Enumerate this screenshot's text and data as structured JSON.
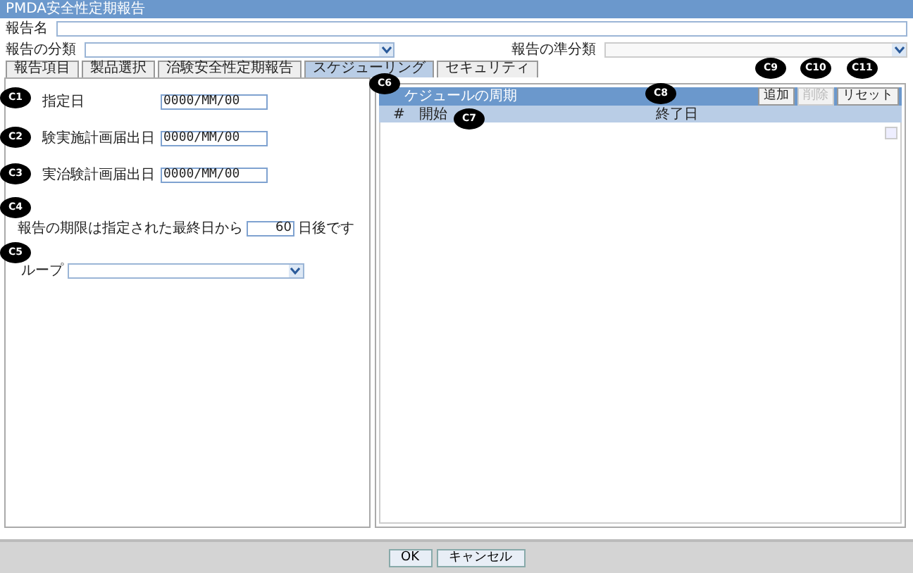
{
  "window": {
    "title": "PMDA安全性定期報告"
  },
  "report_name": {
    "label": "報告名"
  },
  "classification": {
    "label": "報告の分類"
  },
  "sub_classification": {
    "label": "報告の準分類",
    "disabled": true
  },
  "tabs": [
    {
      "label": "報告項目",
      "selected": false
    },
    {
      "label": "製品選択",
      "selected": false
    },
    {
      "label": "治験安全性定期報告",
      "selected": false
    },
    {
      "label": "スケジューリング",
      "selected": true
    },
    {
      "label": "セキュリティ",
      "selected": false
    }
  ],
  "date_fields": [
    {
      "label": "指定日",
      "value": "0000/MM/00"
    },
    {
      "label": "験実施計画届出日",
      "value": "0000/MM/00"
    },
    {
      "label": "実治験計画届出日",
      "value": "0000/MM/00"
    }
  ],
  "deadline": {
    "before": "報告の期限は指定された最終日から",
    "value": "60",
    "after": "日後です"
  },
  "group": {
    "label": "ループ"
  },
  "schedule": {
    "title": "ケジュールの周期",
    "buttons": [
      {
        "label": "追加",
        "disabled": false
      },
      {
        "label": "削除",
        "disabled": true
      },
      {
        "label": "リセット",
        "disabled": false
      }
    ],
    "columns": [
      "#",
      "開始",
      "終了日"
    ]
  },
  "callouts": [
    "C1",
    "C2",
    "C3",
    "C4",
    "C5",
    "C6",
    "C7",
    "C8",
    "C9",
    "C10",
    "C11"
  ],
  "footer_buttons": [
    "OK",
    "キャンセル"
  ]
}
